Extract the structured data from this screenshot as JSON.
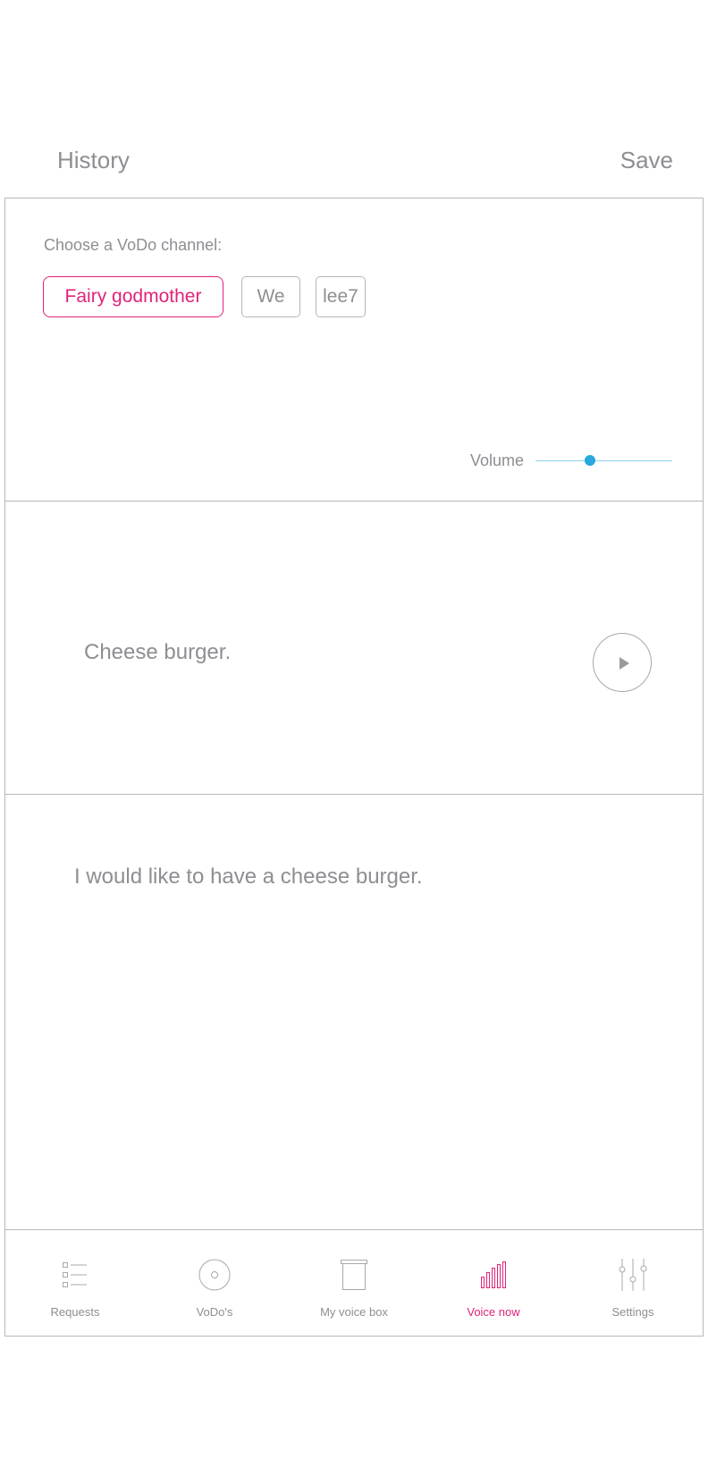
{
  "header": {
    "history_label": "History",
    "save_label": "Save"
  },
  "channel": {
    "prompt": "Choose a VoDo channel:",
    "options": [
      "Fairy godmother",
      "We",
      "lee7"
    ],
    "selected": "Fairy godmother"
  },
  "volume": {
    "label": "Volume",
    "level": 0.4
  },
  "phrase": {
    "text": "Cheese burger.",
    "play_icon": "play-icon"
  },
  "sentence": {
    "text": "I would like to have a cheese burger."
  },
  "tabs": [
    {
      "label": "Requests",
      "icon": "list-icon"
    },
    {
      "label": "VoDo's",
      "icon": "disc-icon"
    },
    {
      "label": "My voice box",
      "icon": "box-icon"
    },
    {
      "label": "Voice now",
      "icon": "voice-bars-icon"
    },
    {
      "label": "Settings",
      "icon": "sliders-icon"
    }
  ],
  "active_tab": "Voice now",
  "colors": {
    "accent": "#e0237a",
    "slider": "#2aa7df",
    "text": "#8e8e93",
    "border": "#b7b7b7"
  }
}
